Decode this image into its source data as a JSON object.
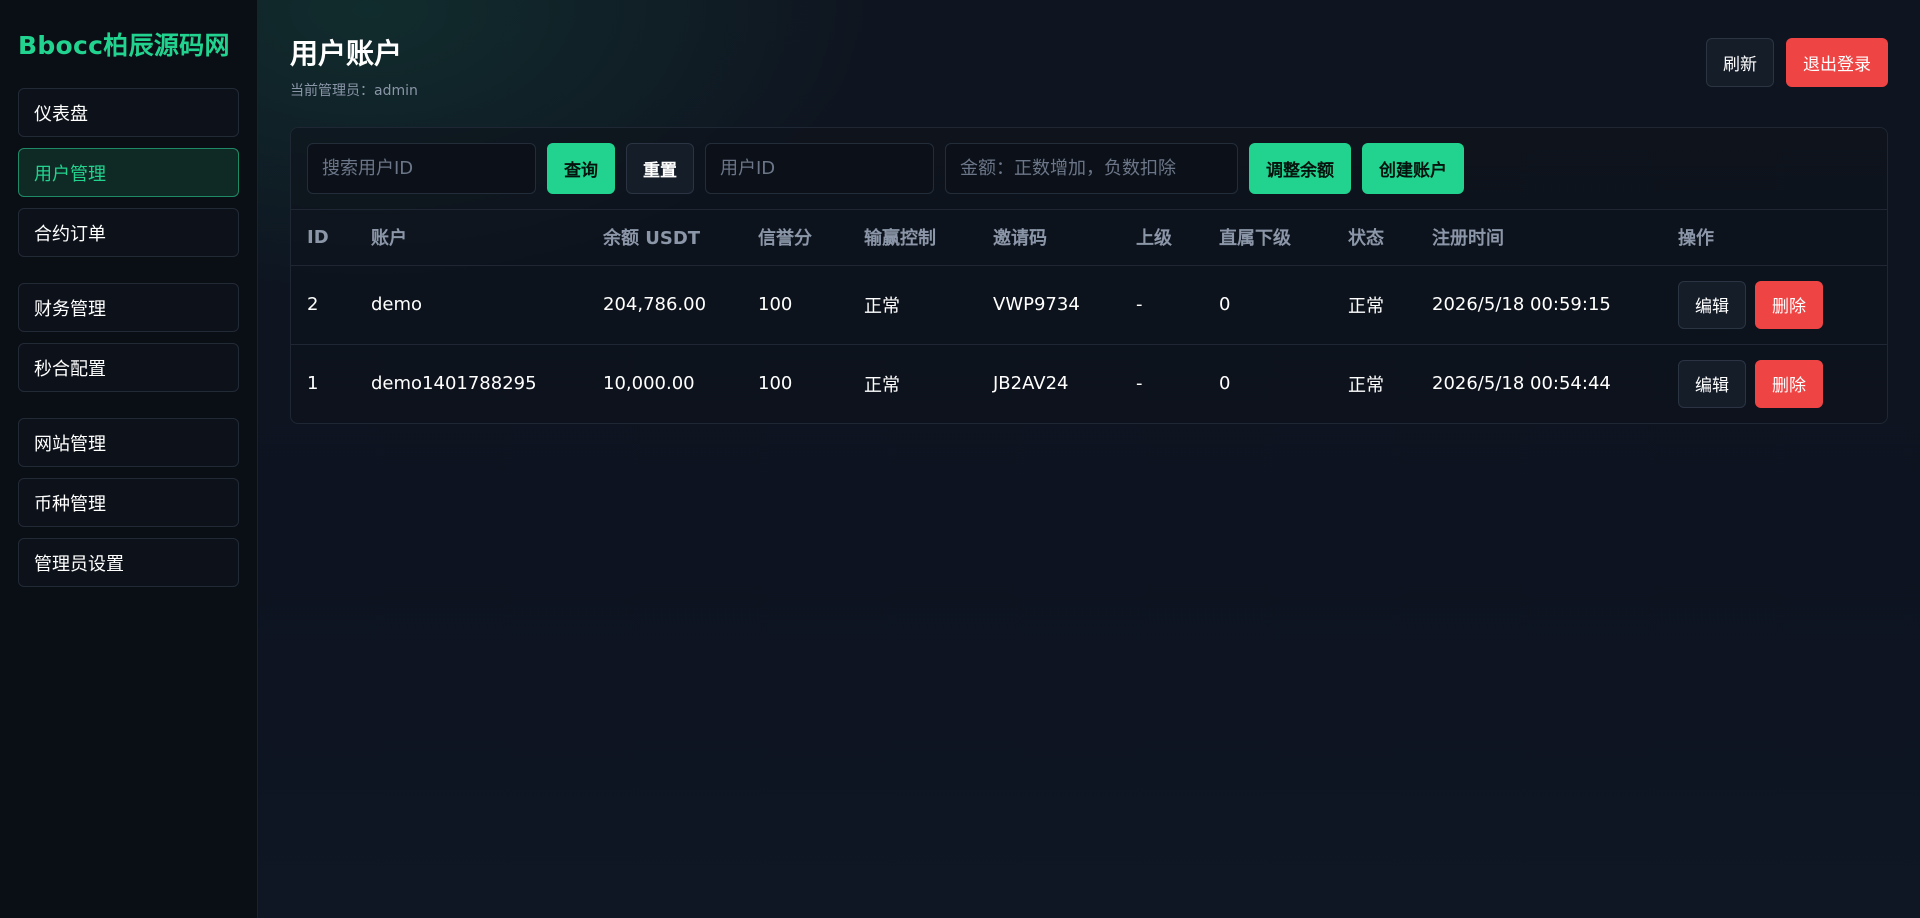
{
  "sidebar": {
    "brand": "Bbocc柏辰源码网",
    "groups": [
      [
        {
          "label": "仪表盘"
        },
        {
          "label": "用户管理",
          "active": true
        },
        {
          "label": "合约订单"
        }
      ],
      [
        {
          "label": "财务管理"
        },
        {
          "label": "秒合配置"
        }
      ],
      [
        {
          "label": "网站管理"
        },
        {
          "label": "币种管理"
        },
        {
          "label": "管理员设置"
        }
      ]
    ]
  },
  "header": {
    "title": "用户账户",
    "subtitle": "当前管理员：admin",
    "refresh_label": "刷新",
    "logout_label": "退出登录"
  },
  "toolbar": {
    "search_placeholder": "搜索用户ID",
    "query_label": "查询",
    "reset_label": "重置",
    "uid_placeholder": "用户ID",
    "amount_placeholder": "金额：正数增加，负数扣除",
    "adjust_label": "调整余额",
    "create_label": "创建账户"
  },
  "table": {
    "columns": [
      "ID",
      "账户",
      "余额 USDT",
      "信誉分",
      "输赢控制",
      "邀请码",
      "上级",
      "直属下级",
      "状态",
      "注册时间",
      "操作"
    ],
    "rows": [
      {
        "id": "2",
        "account": "demo",
        "balance": "204,786.00",
        "credit": "100",
        "control": "正常",
        "invite": "VWP9734",
        "superior": "-",
        "subordinates": "0",
        "status": "正常",
        "registered": "2026/5/18 00:59:15",
        "edit_label": "编辑",
        "delete_label": "删除"
      },
      {
        "id": "1",
        "account": "demo1401788295",
        "balance": "10,000.00",
        "credit": "100",
        "control": "正常",
        "invite": "JB2AV24",
        "superior": "-",
        "subordinates": "0",
        "status": "正常",
        "registered": "2026/5/18 00:54:44",
        "edit_label": "编辑",
        "delete_label": "删除"
      }
    ]
  },
  "colors": {
    "accent": "#22d38f",
    "danger": "#ef4444",
    "background": "#0b0f17"
  }
}
